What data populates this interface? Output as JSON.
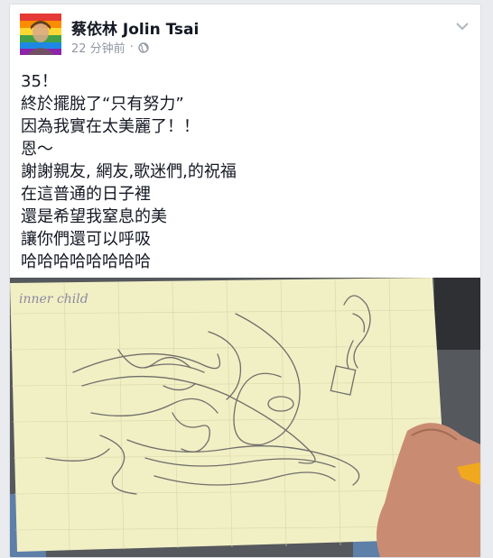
{
  "post": {
    "author": "蔡依林 Jolin Tsai",
    "timestamp": "22 分钟前",
    "separator": "·",
    "audience_icon": "globe-icon",
    "menu_icon": "chevron-down-icon",
    "lines": [
      "35！",
      "終於擺脫了“只有努力”",
      "因為我實在太美麗了！！",
      "恩～",
      "謝謝親友, 網友,歌迷們,的祝福",
      "在這普通的日子裡",
      "還是希望我窒息的美",
      "讓你們還可以呼吸",
      "哈哈哈哈哈哈哈哈"
    ],
    "photo": {
      "handwritten_note": "inner child"
    }
  },
  "colors": {
    "author": "#141823",
    "meta": "#9197a3",
    "paper": "#f1efc4",
    "rainbow": [
      "#e53935",
      "#fb8c00",
      "#fdd835",
      "#43a047",
      "#1e88e5",
      "#8e24aa"
    ]
  }
}
